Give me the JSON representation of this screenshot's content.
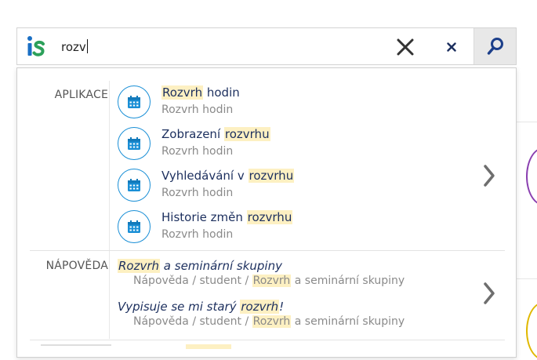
{
  "search": {
    "query": "rozv",
    "placeholder": ""
  },
  "icons": {
    "logo": "is-logo",
    "clear_big": "close-icon",
    "clear_small": "close-small-icon",
    "search": "search-icon",
    "app": "calendar-icon",
    "more": "chevron-right-icon"
  },
  "colors": {
    "logo_blue": "#1a6fc4",
    "logo_green": "#2ca05a",
    "accent": "#1a8fd6",
    "highlight": "#fdf0c2",
    "title_text": "#1c2f5e",
    "muted_text": "#8a8a8a"
  },
  "sections": {
    "apps": {
      "label": "APLIKACE",
      "items": [
        {
          "title_hl": "Rozvrh",
          "title_rest": " hodin",
          "title_pre": "",
          "subtitle": "Rozvrh hodin"
        },
        {
          "title_pre": "Zobrazení ",
          "title_hl": "rozvrhu",
          "title_rest": "",
          "subtitle": "Rozvrh hodin"
        },
        {
          "title_pre": "Vyhledávání v ",
          "title_hl": "rozvrhu",
          "title_rest": "",
          "subtitle": "Rozvrh hodin"
        },
        {
          "title_pre": "Historie změn ",
          "title_hl": "rozvrhu",
          "title_rest": "",
          "subtitle": "Rozvrh hodin"
        }
      ]
    },
    "help": {
      "label": "NÁPOVĚDA",
      "items": [
        {
          "title_pre": "",
          "title_hl": "Rozvrh",
          "title_rest": " a seminární skupiny",
          "path_pre": "Nápověda / student / ",
          "path_hl": "Rozvrh",
          "path_rest": " a seminární skupiny"
        },
        {
          "title_pre": "Vypisuje se mi starý ",
          "title_hl": "rozvrh",
          "title_rest": "!",
          "path_pre": "Nápověda / student / ",
          "path_hl": "Rozvrh",
          "path_rest": " a seminární skupiny"
        }
      ]
    }
  }
}
